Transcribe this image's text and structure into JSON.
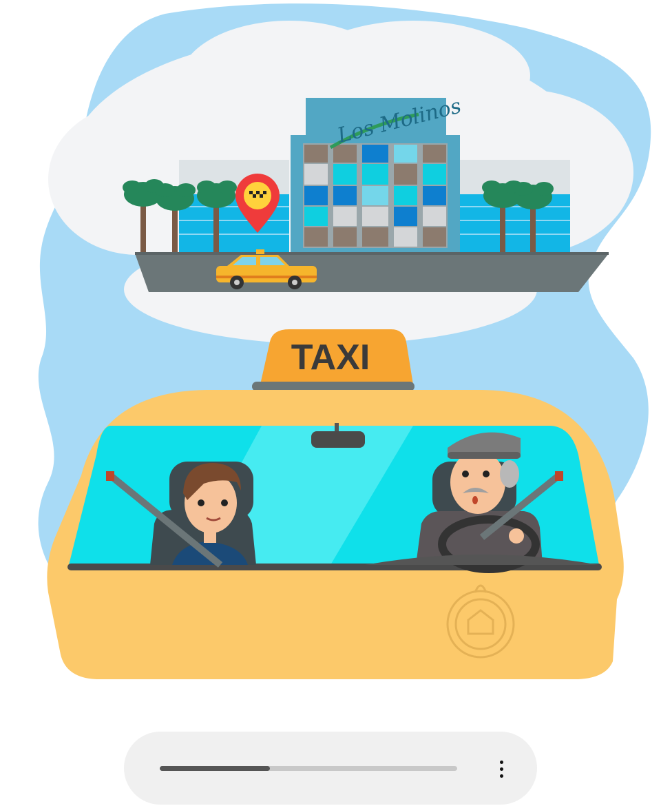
{
  "scene": {
    "roof_sign_text": "TAXI",
    "building_sign_text": "Los Molinos",
    "colors": {
      "sky_blob": "#a8daf6",
      "cloud": "#f3f4f6",
      "taxi_yellow": "#fcc96a",
      "roof_sign": "#f7a531",
      "windshield": "#12d8e8",
      "road": "#6b7678",
      "building_facade": "#52a7c4"
    }
  },
  "player": {
    "progress_fraction": 0.37,
    "menu_icon": "more-vertical-icon"
  }
}
